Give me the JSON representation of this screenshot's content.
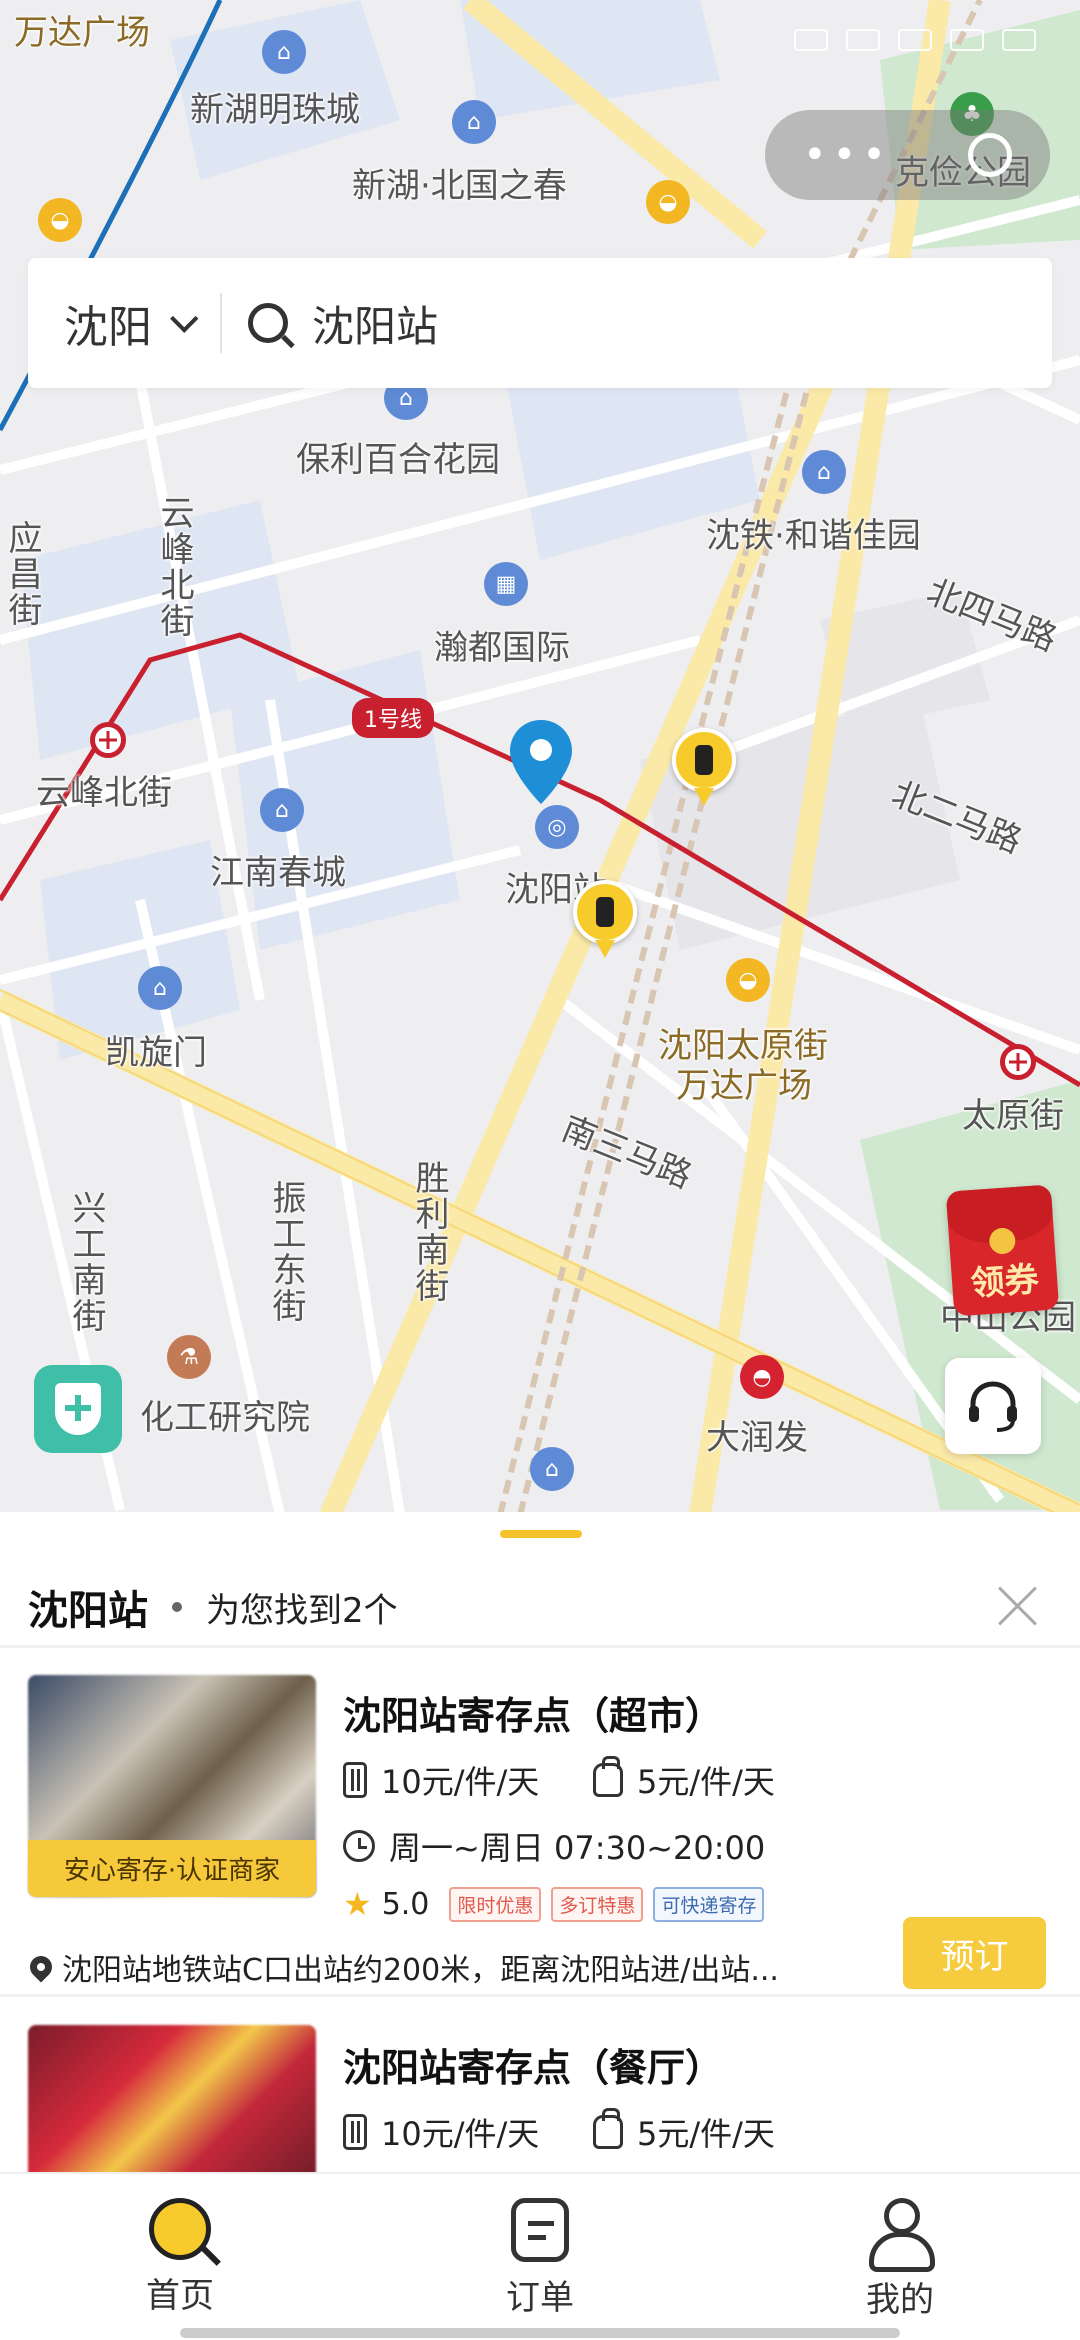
{
  "status_bar": {
    "time": ""
  },
  "map": {
    "labels": {
      "xinhu_pearl": "新湖明珠城",
      "xinhu_spring": "新湖·北国之春",
      "poly_lily": "保利百合花园",
      "shentie": "沈铁·和谐佳园",
      "handu": "瀚都国际",
      "yunfeng_st": "云峰北街",
      "yunfeng_north_st": "云峰北街",
      "jiangnan": "江南春城",
      "shenyang_station": "沈阳站",
      "kaixuanmen": "凯旋门",
      "taiyuan_wanda_1": "沈阳太原街",
      "taiyuan_wanda_2": "万达广场",
      "taiyuan_st": "太原街",
      "bei4malu": "北四马路",
      "bei2malu": "北二马路",
      "nan3malu": "南三马路",
      "shengli_st": "胜利南街",
      "zhengong_st": "振工东街",
      "xinggong_st": "兴工南街",
      "chem_institute": "化工研究院",
      "darunfa": "大润发",
      "zhongshan_park": "中山公园",
      "keijian_park": "克俭公园",
      "wanda_plaza_top": "万达广场",
      "yingchang": "应昌街",
      "line1": "1号线"
    }
  },
  "search": {
    "city": "沈阳",
    "query": "沈阳站"
  },
  "coupon": {
    "label": "领券"
  },
  "sheet": {
    "title": "沈阳站",
    "count_text": "为您找到2个"
  },
  "cards": [
    {
      "name": "沈阳站寄存点（超市）",
      "price_large": "10元/件/天",
      "price_small": "5元/件/天",
      "hours": "周一~周日 07:30~20:00",
      "badge": "安心寄存·认证商家",
      "rating": "5.0",
      "tags": [
        "限时优惠",
        "多订特惠",
        "可快递寄存"
      ],
      "address": "沈阳站地铁站C口出站约200米，距离沈阳站进/出站...",
      "book_label": "预订"
    },
    {
      "name": "沈阳站寄存点（餐厅）",
      "price_large": "10元/件/天",
      "price_small": "5元/件/天"
    }
  ],
  "tabs": [
    {
      "label": "首页",
      "icon": "search-icon"
    },
    {
      "label": "订单",
      "icon": "order-icon"
    },
    {
      "label": "我的",
      "icon": "person-icon"
    }
  ],
  "colors": {
    "accent": "#F6CC3E",
    "metro_red": "#C8202F",
    "pin_blue": "#1E8FD6"
  }
}
